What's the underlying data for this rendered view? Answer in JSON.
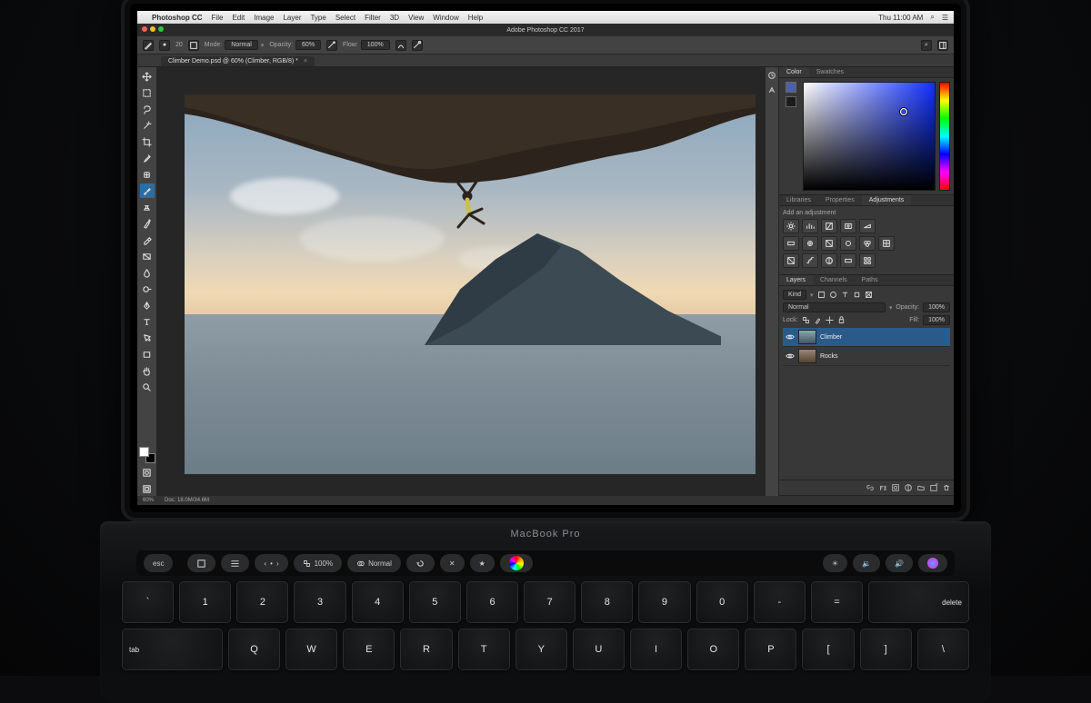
{
  "system": {
    "menubar": {
      "app_name": "Photoshop CC",
      "items": [
        "File",
        "Edit",
        "Image",
        "Layer",
        "Type",
        "Select",
        "Filter",
        "3D",
        "View",
        "Window",
        "Help"
      ],
      "clock": "Thu 11:00 AM"
    }
  },
  "laptop": {
    "model_label": "MacBook Pro",
    "touchbar": {
      "esc": "esc",
      "items": [
        {
          "icon": "rect",
          "label": ""
        },
        {
          "icon": "sliders",
          "label": ""
        },
        {
          "icon": "plus-minus",
          "label": ""
        },
        {
          "icon": "opacity",
          "label": "100%"
        },
        {
          "icon": "blend",
          "label": "Normal"
        },
        {
          "icon": "refresh",
          "label": ""
        },
        {
          "icon": "x",
          "label": ""
        },
        {
          "icon": "star",
          "label": ""
        },
        {
          "icon": "sound-low",
          "label": ""
        },
        {
          "icon": "sound-high",
          "label": ""
        },
        {
          "icon": "siri",
          "label": ""
        }
      ]
    },
    "keys_r1": [
      "`",
      "1",
      "2",
      "3",
      "4",
      "5",
      "6",
      "7",
      "8",
      "9",
      "0",
      "-",
      "=",
      "delete"
    ],
    "keys_r2": [
      "tab",
      "Q",
      "W",
      "E",
      "R",
      "T",
      "Y",
      "U",
      "I",
      "O",
      "P"
    ]
  },
  "app": {
    "window_title": "Adobe Photoshop CC 2017",
    "document_tab": "Climber Demo.psd @ 60% (Climber, RGB/8) *",
    "options_bar": {
      "brush_size": "20",
      "mode_label": "Mode:",
      "mode_value": "Normal",
      "opacity_label": "Opacity:",
      "opacity_value": "60%",
      "flow_label": "Flow:",
      "flow_value": "100%"
    },
    "tools": [
      "move",
      "marquee",
      "lasso",
      "wand",
      "crop",
      "eyedropper",
      "brush-heal",
      "brush",
      "stamp",
      "history-brush",
      "eraser",
      "gradient",
      "blur",
      "dodge",
      "pen",
      "type",
      "path",
      "rect",
      "hand",
      "zoom"
    ],
    "status": {
      "zoom": "60%",
      "info": "Doc: 18.0M/34.6M"
    },
    "panels": {
      "color_tabs": [
        "Color",
        "Swatches"
      ],
      "properties_tabs": [
        "Libraries",
        "Properties",
        "Adjustments"
      ],
      "adjustments_label": "Add an adjustment",
      "layers_tabs": [
        "Layers",
        "Channels",
        "Paths"
      ],
      "layers": {
        "kind_label": "Kind",
        "blend_label": "Normal",
        "opacity_label": "Opacity:",
        "opacity_value": "100%",
        "lock_label": "Lock:",
        "fill_label": "Fill:",
        "fill_value": "100%",
        "rows": [
          {
            "name": "Climber",
            "selected": true
          },
          {
            "name": "Rocks",
            "selected": false
          }
        ]
      }
    }
  }
}
